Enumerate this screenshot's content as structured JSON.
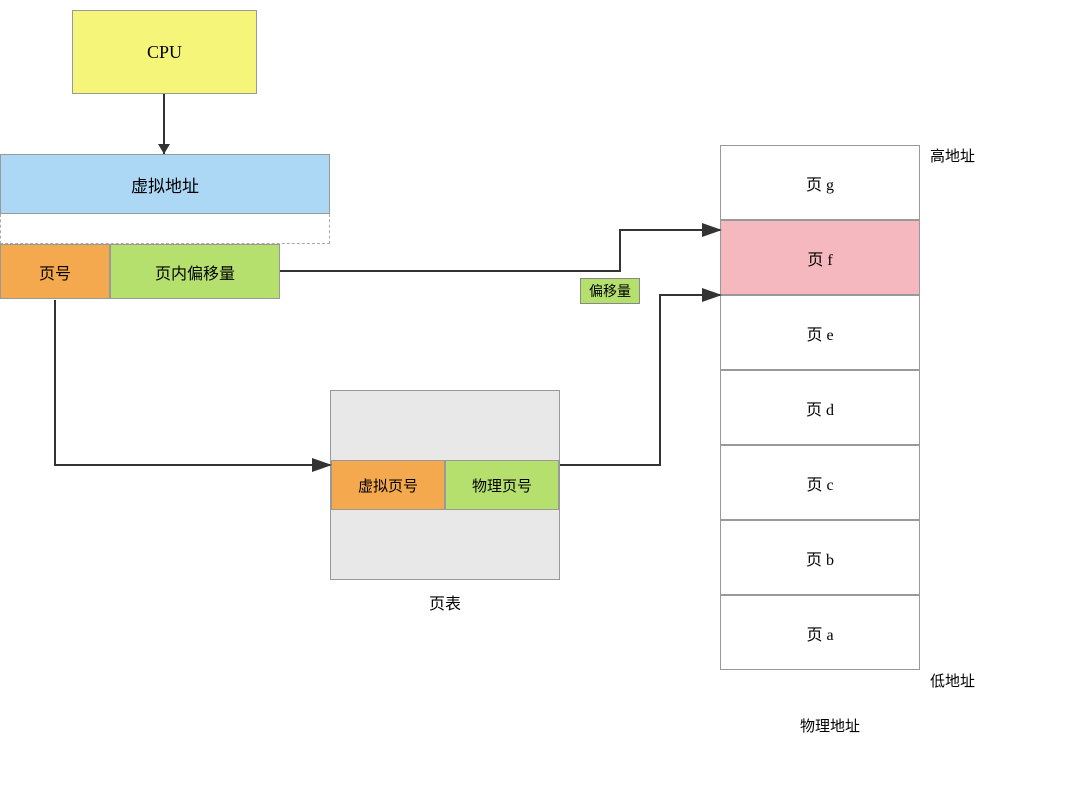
{
  "cpu": {
    "label": "CPU"
  },
  "virtual_address": {
    "label": "虚拟地址"
  },
  "page_num": {
    "label": "页号"
  },
  "page_inner_offset": {
    "label": "页内偏移量"
  },
  "page_table": {
    "label": "页表",
    "virtual_col": "虚拟页号",
    "physical_col": "物理页号"
  },
  "offset_label": {
    "label": "偏移量"
  },
  "physical_memory": {
    "label": "物理地址",
    "high_label": "高地址",
    "low_label": "低地址",
    "pages": [
      {
        "label": "页 g",
        "highlighted": false
      },
      {
        "label": "页 f",
        "highlighted": true
      },
      {
        "label": "页 e",
        "highlighted": false
      },
      {
        "label": "页 d",
        "highlighted": false
      },
      {
        "label": "页 c",
        "highlighted": false
      },
      {
        "label": "页 b",
        "highlighted": false
      },
      {
        "label": "页 a",
        "highlighted": false
      }
    ]
  }
}
